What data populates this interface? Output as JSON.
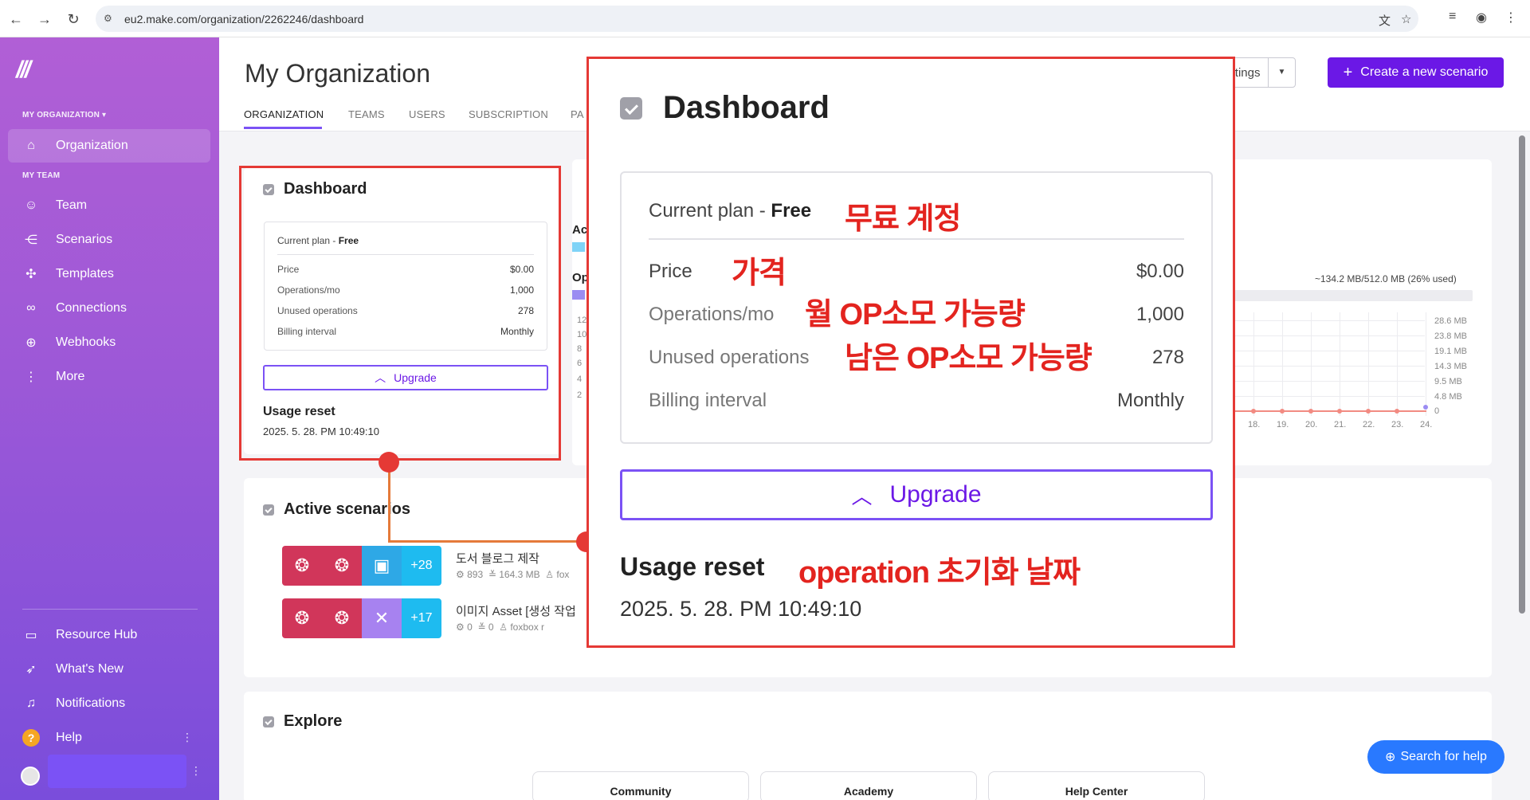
{
  "browser": {
    "url": "eu2.make.com/organization/2262246/dashboard"
  },
  "sidebar": {
    "section_org": "MY ORGANIZATION ▾",
    "section_team": "MY TEAM",
    "items": [
      {
        "label": "Organization"
      },
      {
        "label": "Team"
      },
      {
        "label": "Scenarios"
      },
      {
        "label": "Templates"
      },
      {
        "label": "Connections"
      },
      {
        "label": "Webhooks"
      },
      {
        "label": "More"
      }
    ],
    "bottom": [
      {
        "label": "Resource Hub"
      },
      {
        "label": "What's New"
      },
      {
        "label": "Notifications"
      },
      {
        "label": "Help"
      }
    ]
  },
  "header": {
    "title": "My Organization",
    "tabs": [
      "ORGANIZATION",
      "TEAMS",
      "USERS",
      "SUBSCRIPTION",
      "PA"
    ],
    "org_settings": "Organization settings",
    "create_scenario": "Create a new scenario"
  },
  "dashboard_small": {
    "title": "Dashboard",
    "current_plan_label": "Current plan - ",
    "current_plan_value": "Free",
    "rows": [
      {
        "label": "Price",
        "value": "$0.00"
      },
      {
        "label": "Operations/mo",
        "value": "1,000"
      },
      {
        "label": "Unused operations",
        "value": "278"
      },
      {
        "label": "Billing interval",
        "value": "Monthly"
      }
    ],
    "upgrade": "Upgrade",
    "usage_reset_title": "Usage reset",
    "usage_reset_date": "2025. 5. 28. PM 10:49:10"
  },
  "dashboard_zoom": {
    "title": "Dashboard",
    "current_plan_label": "Current plan - ",
    "current_plan_value": "Free",
    "rows": [
      {
        "label": "Price",
        "value": "$0.00"
      },
      {
        "label": "Operations/mo",
        "value": "1,000"
      },
      {
        "label": "Unused operations",
        "value": "278"
      },
      {
        "label": "Billing interval",
        "value": "Monthly"
      }
    ],
    "upgrade": "Upgrade",
    "usage_reset_title": "Usage reset",
    "usage_reset_date": "2025. 5. 28. PM 10:49:10"
  },
  "annotations": {
    "free_account": "무료 계정",
    "price": "가격",
    "monthly_ops": "월 OP소모 가능량",
    "remaining_ops": "남은 OP소모 가능량",
    "reset_date": "operation 초기화 날짜"
  },
  "active_scenarios": {
    "title": "Active scenarios",
    "rows": [
      {
        "name": "도서 블로그 제작",
        "ops": "893",
        "data": "164.3 MB",
        "owner": "fox",
        "more": "+28"
      },
      {
        "name": "이미지 Asset [생성 작업",
        "ops": "0",
        "data": "0",
        "owner": "foxbox r",
        "more": "+17"
      }
    ]
  },
  "usage_chart": {
    "partial_labels": [
      "Ac",
      "Op"
    ],
    "storage_text": "~134.2 MB/512.0 MB (26% used)",
    "y_ticks": [
      "28.6 MB",
      "23.8 MB",
      "19.1 MB",
      "14.3 MB",
      "9.5 MB",
      "4.8 MB",
      "0"
    ],
    "x_ticks": [
      "18.",
      "19.",
      "20.",
      "21.",
      "22.",
      "23.",
      "24."
    ],
    "left_ticks": [
      "12",
      "10",
      "8",
      "6",
      "4",
      "2"
    ]
  },
  "explore": {
    "title": "Explore",
    "cards": [
      "Community",
      "Academy",
      "Help Center"
    ]
  },
  "help_search": "Search for help",
  "colors": {
    "brand_purple": "#6b18e6",
    "annotation_red": "#e53935",
    "help_blue": "#2979ff"
  }
}
